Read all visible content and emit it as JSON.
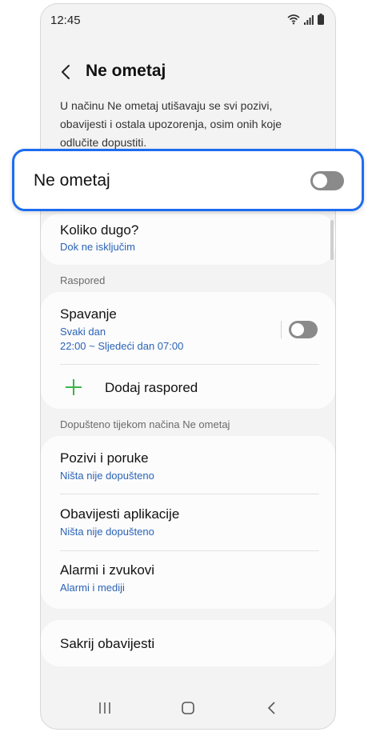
{
  "status_bar": {
    "time": "12:45"
  },
  "header": {
    "title": "Ne ometaj"
  },
  "description": "U načinu Ne ometaj utišavaju se svi pozivi, obavijesti i ostala upozorenja, osim onih koje odlučite dopustiti.",
  "main_toggle": {
    "label": "Ne ometaj",
    "state": "off"
  },
  "duration": {
    "title": "Koliko dugo?",
    "value": "Dok ne isključim"
  },
  "schedule": {
    "section_label": "Raspored",
    "items": [
      {
        "title": "Spavanje",
        "days": "Svaki dan",
        "time": "22:00 ~ Sljedeći dan 07:00",
        "state": "off"
      }
    ],
    "add_label": "Dodaj raspored"
  },
  "allowed": {
    "section_label": "Dopušteno tijekom načina Ne ometaj",
    "items": [
      {
        "title": "Pozivi i poruke",
        "value": "Ništa nije dopušteno"
      },
      {
        "title": "Obavijesti aplikacije",
        "value": "Ništa nije dopušteno"
      },
      {
        "title": "Alarmi i zvukovi",
        "value": "Alarmi i mediji"
      }
    ]
  },
  "hide_notifications": {
    "title": "Sakrij obavijesti"
  },
  "colors": {
    "accent": "#1d6cf0",
    "link": "#2b63b6",
    "plus": "#3bb54a",
    "toggle_off": "#8a8a8a"
  },
  "icons": [
    "back-arrow-icon",
    "wifi-icon",
    "signal-icon",
    "battery-icon",
    "plus-icon",
    "recents-icon",
    "home-icon",
    "back-nav-icon"
  ]
}
